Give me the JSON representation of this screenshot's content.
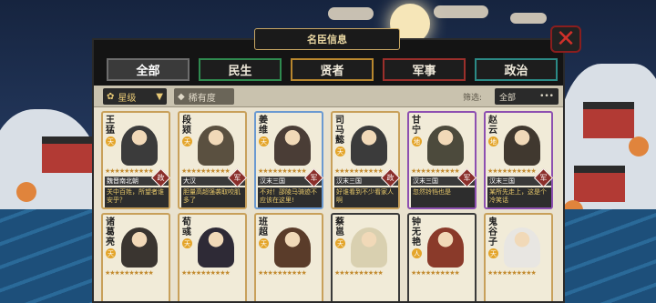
{
  "window": {
    "title": "名臣信息"
  },
  "tabs": [
    {
      "label": "全部",
      "color": "#6d6d6d",
      "active": true
    },
    {
      "label": "民生",
      "color": "#2f8a4f",
      "active": false
    },
    {
      "label": "贤者",
      "color": "#b8872e",
      "active": false
    },
    {
      "label": "军事",
      "color": "#9b2f2b",
      "active": false
    },
    {
      "label": "政治",
      "color": "#2b8a86",
      "active": false
    }
  ],
  "filters": {
    "sort_primary": "星级",
    "sort_secondary": "稀有度",
    "filter_label": "筛选:",
    "filter_value": "全部"
  },
  "cards": [
    {
      "name": "王猛",
      "badge": "天",
      "stars": "★★★★★★★★★★",
      "skill": "魏晋南北朝",
      "type": "政",
      "desc": "关中百姓，所望者谁安乎？",
      "border": "gold",
      "portrait": "#3b3b3b"
    },
    {
      "name": "段颎",
      "badge": "天",
      "stars": "★★★★★★★★★★",
      "skill": "大汉",
      "type": "军",
      "desc": "胆量高超强袭取咬肌多了",
      "border": "gold",
      "portrait": "#5a5040"
    },
    {
      "name": "姜维",
      "badge": "天",
      "stars": "★★★★★★★★★★",
      "skill": "汉末三国",
      "type": "军",
      "desc": "不对！邵陵马骑迹不应该在这里!",
      "border": "blue",
      "portrait": "#4a3d36"
    },
    {
      "name": "司马懿",
      "badge": "天",
      "stars": "★★★★★★★★★★",
      "skill": "汉末三国",
      "type": "政",
      "desc": "好谁看到不少看家人啊",
      "border": "gold",
      "portrait": "#3b3b3b"
    },
    {
      "name": "甘宁",
      "badge": "地",
      "stars": "★★★★★★★★★★",
      "skill": "汉末三国",
      "type": "军",
      "desc": "忽然铃铛也是",
      "border": "purple",
      "portrait": "#4c4a3c"
    },
    {
      "name": "赵云",
      "badge": "地",
      "stars": "★★★★★★★★★★",
      "skill": "汉末三国",
      "type": "军",
      "desc": "某所先走上，这是个冷笑话",
      "border": "purple",
      "portrait": "#40382f"
    },
    {
      "name": "诸葛亮",
      "badge": "天",
      "stars": "★★★★★★★★★★",
      "skill": "",
      "type": "",
      "desc": "",
      "border": "gold",
      "portrait": "#3a3530"
    },
    {
      "name": "荀彧",
      "badge": "天",
      "stars": "★★★★★★★★★★",
      "skill": "",
      "type": "",
      "desc": "",
      "border": "gold",
      "portrait": "#2e2a36"
    },
    {
      "name": "班超",
      "badge": "天",
      "stars": "★★★★★★★★★★",
      "skill": "",
      "type": "",
      "desc": "",
      "border": "gold",
      "portrait": "#5a3c2a"
    },
    {
      "name": "蔡邕",
      "badge": "天",
      "stars": "★★★★★★★★★★",
      "skill": "",
      "type": "",
      "desc": "",
      "border": "dark",
      "portrait": "#d9d0b0"
    },
    {
      "name": "钟无艳",
      "badge": "人",
      "stars": "★★★★★★★★★★",
      "skill": "",
      "type": "",
      "desc": "",
      "border": "dark",
      "portrait": "#8a3a2a"
    },
    {
      "name": "鬼谷子",
      "badge": "天",
      "stars": "★★★★★★★★★★",
      "skill": "",
      "type": "",
      "desc": "",
      "border": "gold",
      "portrait": "#e8e6e2"
    }
  ]
}
